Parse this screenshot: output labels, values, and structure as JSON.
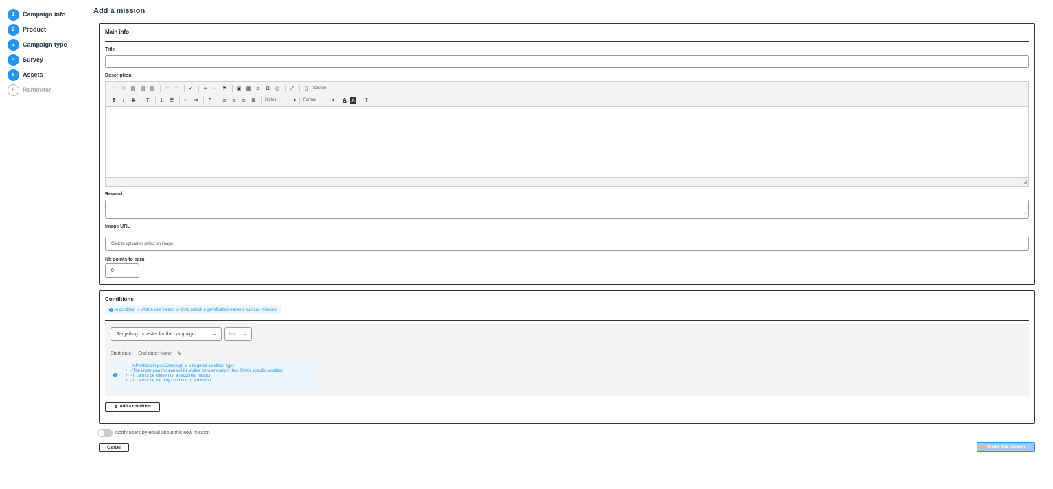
{
  "page_title": "Add a mission",
  "steps": [
    {
      "num": "1",
      "label": "Campaign info"
    },
    {
      "num": "2",
      "label": "Product"
    },
    {
      "num": "3",
      "label": "Campaign type"
    },
    {
      "num": "4",
      "label": "Survey"
    },
    {
      "num": "5",
      "label": "Assets"
    },
    {
      "num": "6",
      "label": "Reminder"
    }
  ],
  "main_info": {
    "header": "Main info",
    "title_label": "Title",
    "title_value": "",
    "description_label": "Description",
    "editor": {
      "source_label": "Source",
      "styles_label": "Styles",
      "format_label": "Format",
      "content": ""
    },
    "reward_label": "Reward",
    "reward_value": "",
    "image_url_label": "Image URL",
    "image_url_placeholder": "Click to upload or select an image",
    "points_label": "Nb points to earn",
    "points_value": "0"
  },
  "conditions": {
    "header": "Conditions",
    "info_text": "A condition is what a user needs to do to unlock a gamification element such as missions",
    "targeting_select": "Targetting: Is tester for the campaign",
    "campaign_select": "test",
    "start_date": "Start date:",
    "end_date": "End date: None",
    "condition_info_title": "IsParticipatingInACampaign is a targeted condition type:",
    "condition_info_lines": [
      "- The underlying mission will be visible for users only if they fill this specific condition",
      "- It cannot be chosen on a reccurent mission",
      "- It cannot be the only condition of a mission"
    ],
    "add_button": "Add a condition"
  },
  "notify_label": "Notify users by email about this new mission",
  "notify_on": false,
  "cancel_label": "Cancel",
  "create_label": "Create this mission",
  "colors": {
    "accent": "#2196f3",
    "info_bg": "#eef6fd",
    "create_bg": "#a9c7e2"
  }
}
